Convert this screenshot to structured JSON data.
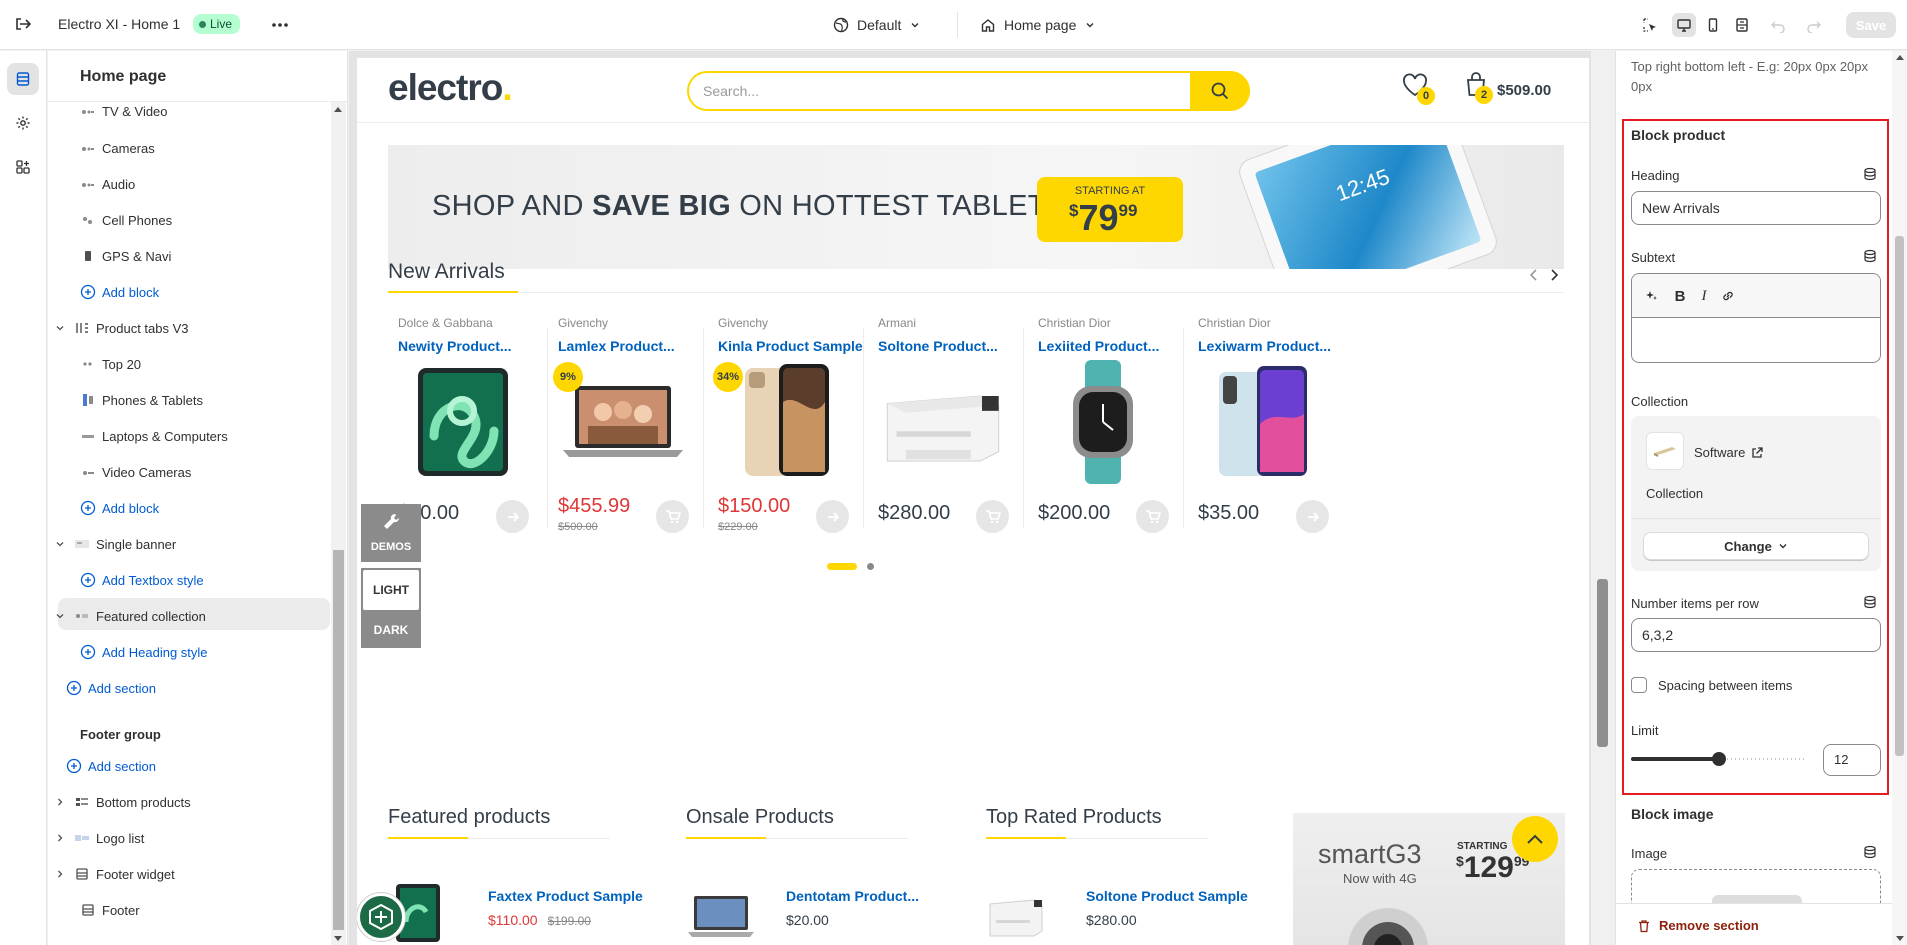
{
  "topbar": {
    "title": "Electro XI - Home 1",
    "live_badge": "Live",
    "theme_select": "Default",
    "page_select": "Home page",
    "save_label": "Save"
  },
  "tree": {
    "header": "Home page",
    "items": [
      {
        "label": "TV & Video",
        "kind": "block"
      },
      {
        "label": "Cameras",
        "kind": "block"
      },
      {
        "label": "Audio",
        "kind": "block"
      },
      {
        "label": "Cell Phones",
        "kind": "block"
      },
      {
        "label": "GPS & Navi",
        "kind": "block"
      },
      {
        "label": "Add block",
        "kind": "add"
      },
      {
        "label": "Product tabs V3",
        "kind": "section"
      },
      {
        "label": "Top 20",
        "kind": "block"
      },
      {
        "label": "Phones & Tablets",
        "kind": "block"
      },
      {
        "label": "Laptops & Computers",
        "kind": "block"
      },
      {
        "label": "Video Cameras",
        "kind": "block"
      },
      {
        "label": "Add block",
        "kind": "add"
      },
      {
        "label": "Single banner",
        "kind": "section"
      },
      {
        "label": "Add Textbox style",
        "kind": "add"
      },
      {
        "label": "Featured collection",
        "kind": "section",
        "selected": true
      },
      {
        "label": "Add Heading style",
        "kind": "add"
      },
      {
        "label": "Add section",
        "kind": "add"
      }
    ],
    "footer_group": {
      "title": "Footer group",
      "items": [
        {
          "label": "Add section",
          "kind": "add"
        },
        {
          "label": "Bottom products",
          "kind": "section"
        },
        {
          "label": "Logo list",
          "kind": "section"
        },
        {
          "label": "Footer widget",
          "kind": "section"
        },
        {
          "label": "Footer",
          "kind": "section"
        }
      ]
    }
  },
  "preview": {
    "logo": "electro",
    "logo_dot": ".",
    "search_placeholder": "Search...",
    "wishlist_count": "0",
    "cart_count": "2",
    "cart_total": "$509.00",
    "banner": {
      "text_pre": "SHOP AND ",
      "text_bold": "SAVE BIG",
      "text_post": " ON HOTTEST TABLETS",
      "price_label": "STARTING AT",
      "price_currency": "$",
      "price_whole": "79",
      "price_cents": "99",
      "tablet_clock": "12:45"
    },
    "new_arrivals": {
      "title": "New Arrivals",
      "products": [
        {
          "brand": "Dolce & Gabbana",
          "name": "Newity Product...",
          "price": "$80.00",
          "old_price": "",
          "discount": "",
          "image": "tablet-icon"
        },
        {
          "brand": "Givenchy",
          "name": "Lamlex Product...",
          "price": "$455.99",
          "old_price": "$500.00",
          "discount": "9%",
          "image": "laptop-icon"
        },
        {
          "brand": "Givenchy",
          "name": "Kinla Product Sample",
          "price": "$150.00",
          "old_price": "$229.00",
          "discount": "34%",
          "image": "phone-icon"
        },
        {
          "brand": "Armani",
          "name": "Soltone Product...",
          "price": "$280.00",
          "old_price": "",
          "discount": "",
          "image": "printer-icon"
        },
        {
          "brand": "Christian Dior",
          "name": "Lexiited Product...",
          "price": "$200.00",
          "old_price": "",
          "discount": "",
          "image": "watch-icon"
        },
        {
          "brand": "Christian Dior",
          "name": "Lexiwarm Product...",
          "price": "$35.00",
          "old_price": "",
          "discount": "",
          "image": "phone-icon"
        }
      ]
    },
    "demos_label": "DEMOS",
    "light_label": "LIGHT",
    "dark_label": "DARK",
    "bottom": {
      "featured_title": "Featured products",
      "onsale_title": "Onsale Products",
      "toprated_title": "Top Rated Products",
      "featured_item": {
        "name": "Faxtex Product Sample",
        "price": "$110.00",
        "old_price": "$199.00"
      },
      "onsale_item": {
        "name": "Dentotam Product...",
        "price": "$20.00"
      },
      "toprated_item": {
        "name": "Soltone Product Sample",
        "price": "$280.00"
      },
      "promo": {
        "brand": "smartG3",
        "sub": "Now with 4G",
        "label": "STARTING",
        "price_currency": "$",
        "price_whole": "129",
        "price_cents": "99"
      }
    }
  },
  "settings": {
    "padding_hint": "Top right bottom left - E.g: 20px 0px 20px 0px",
    "block_product_title": "Block product",
    "heading_label": "Heading",
    "heading_value": "New Arrivals",
    "subtext_label": "Subtext",
    "collection_label": "Collection",
    "collection_name": "Software",
    "collection_sub": "Collection",
    "change_label": "Change",
    "items_per_row_label": "Number items per row",
    "items_per_row_value": "6,3,2",
    "spacing_label": "Spacing between items",
    "spacing_checked": false,
    "limit_label": "Limit",
    "limit_value": "12",
    "limit_fraction": 0.5,
    "block_image_title": "Block image",
    "image_label": "Image",
    "remove_section_label": "Remove section"
  },
  "colors": {
    "brand_yellow": "#fed700",
    "link_blue": "#0062bd",
    "sale_red": "#df3737",
    "highlight_red": "#e51c23"
  }
}
